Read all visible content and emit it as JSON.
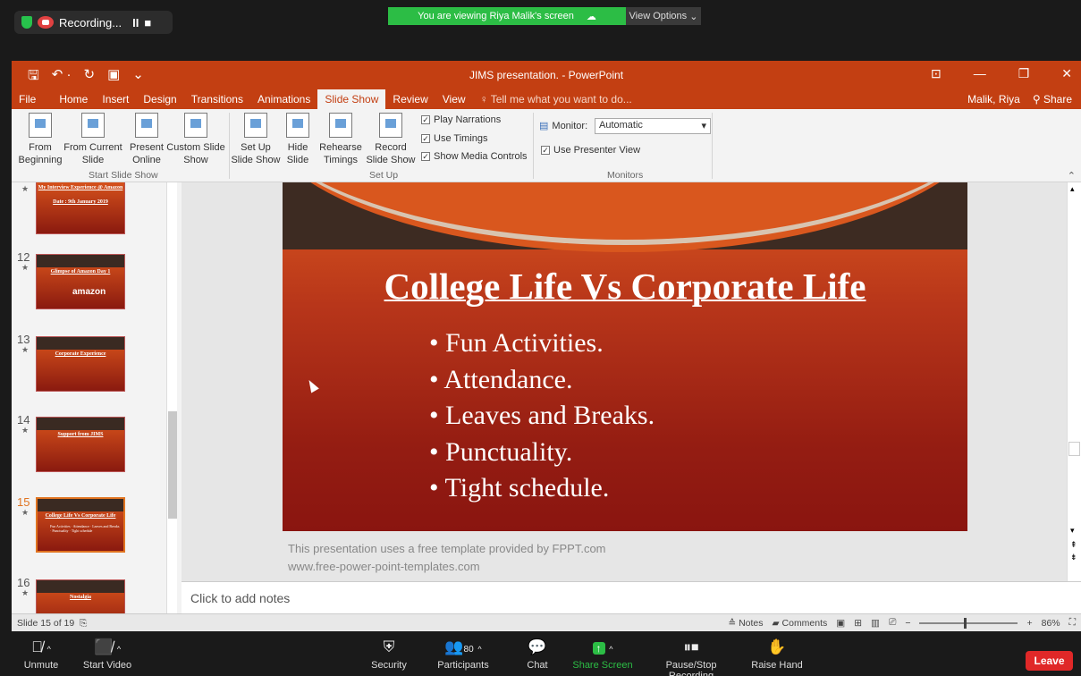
{
  "zoom": {
    "recording_label": "Recording...",
    "pause_glyph": "II",
    "stop_glyph": "■",
    "viewing_banner": "You are viewing Riya Malik's screen",
    "view_options": "View Options",
    "participants_count": "80",
    "toolbar": [
      {
        "id": "unmute",
        "label": "Unmute",
        "icon": "mic-off-icon"
      },
      {
        "id": "start-video",
        "label": "Start Video",
        "icon": "video-off-icon"
      },
      {
        "id": "security",
        "label": "Security",
        "icon": "shield-icon"
      },
      {
        "id": "participants",
        "label": "Participants",
        "icon": "participants-icon"
      },
      {
        "id": "chat",
        "label": "Chat",
        "icon": "chat-icon"
      },
      {
        "id": "share-screen",
        "label": "Share Screen",
        "icon": "share-icon"
      },
      {
        "id": "pause-recording",
        "label": "Pause/Stop Recording",
        "icon": "pause-stop-icon"
      },
      {
        "id": "raise-hand",
        "label": "Raise Hand",
        "icon": "hand-icon"
      }
    ],
    "leave_label": "Leave",
    "accent_green": "#2cbd45",
    "leave_red": "#e02828"
  },
  "ppt": {
    "window_title": "JIMS presentation. - PowerPoint",
    "menu": [
      "File",
      "Home",
      "Insert",
      "Design",
      "Transitions",
      "Animations",
      "Slide Show",
      "Review",
      "View"
    ],
    "active_menu": "Slide Show",
    "tell_me": "Tell me what you want to do...",
    "user_name": "Malik, Riya",
    "share_label": "Share",
    "ribbon": {
      "from_beginning": "From Beginning",
      "from_current": "From Current Slide",
      "present_online": "Present Online",
      "custom_slide_show": "Custom Slide Show",
      "set_up_slide_show": "Set Up Slide Show",
      "hide_slide": "Hide Slide",
      "rehearse_timings": "Rehearse Timings",
      "record_slide_show": "Record Slide Show",
      "group_start": "Start Slide Show",
      "group_setup": "Set Up",
      "group_monitors": "Monitors",
      "play_narrations": "Play Narrations",
      "use_timings": "Use Timings",
      "show_media_controls": "Show Media Controls",
      "monitor_label": "Monitor:",
      "monitor_value": "Automatic",
      "use_presenter_view": "Use Presenter View"
    },
    "thumbnails": [
      {
        "num": "",
        "title": "My Interview Experience @ Amazon",
        "sub": "Date : 9th January 2019"
      },
      {
        "num": "12",
        "title": "Glimpse of Amazon Day 1",
        "sub": "amazon"
      },
      {
        "num": "13",
        "title": "Corporate Experience",
        "sub": ""
      },
      {
        "num": "14",
        "title": "Support from JIMS",
        "sub": ""
      },
      {
        "num": "15",
        "title": "College Life Vs Corporate Life",
        "sub": "Fun Activities · Attendance · Leaves and Breaks · Punctuality · Tight schedule"
      },
      {
        "num": "16",
        "title": "Nostalgia",
        "sub": ""
      }
    ],
    "slide": {
      "title": "College Life Vs Corporate Life",
      "bullets": [
        "Fun Activities.",
        "Attendance.",
        "Leaves and Breaks.",
        "Punctuality.",
        "Tight schedule."
      ],
      "footer_line1": "This presentation uses a free template provided by FPPT.com",
      "footer_line2": "www.free-power-point-templates.com"
    },
    "notes_placeholder": "Click to add notes",
    "status_slide": "Slide 15 of 19",
    "status_notes": "Notes",
    "status_comments": "Comments",
    "zoom_level": "86%",
    "accent": "#c33f12"
  }
}
